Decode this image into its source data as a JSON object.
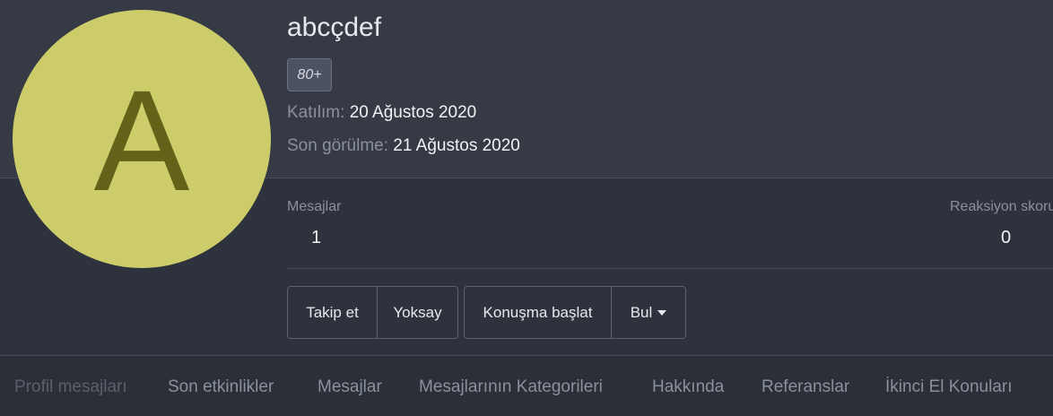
{
  "profile": {
    "avatar_letter": "A",
    "avatar_color": "#cccc6a",
    "avatar_letter_color": "#626219",
    "username": "abcçdef",
    "badge": "80+",
    "joined_label": "Katılım:",
    "joined_value": "20 Ağustos 2020",
    "seen_label": "Son görülme:",
    "seen_value": "21 Ağustos 2020"
  },
  "stats": {
    "messages_label": "Mesajlar",
    "messages_value": "1",
    "reaction_label": "Reaksiyon skoru",
    "reaction_value": "0"
  },
  "actions": {
    "follow": "Takip et",
    "ignore": "Yoksay",
    "start_conversation": "Konuşma başlat",
    "find": "Bul"
  },
  "tabs": [
    "Profil mesajları",
    "Son etkinlikler",
    "Mesajlar",
    "Mesajlarının Kategorileri",
    "Hakkında",
    "Referanslar",
    "İkinci El Konuları"
  ]
}
